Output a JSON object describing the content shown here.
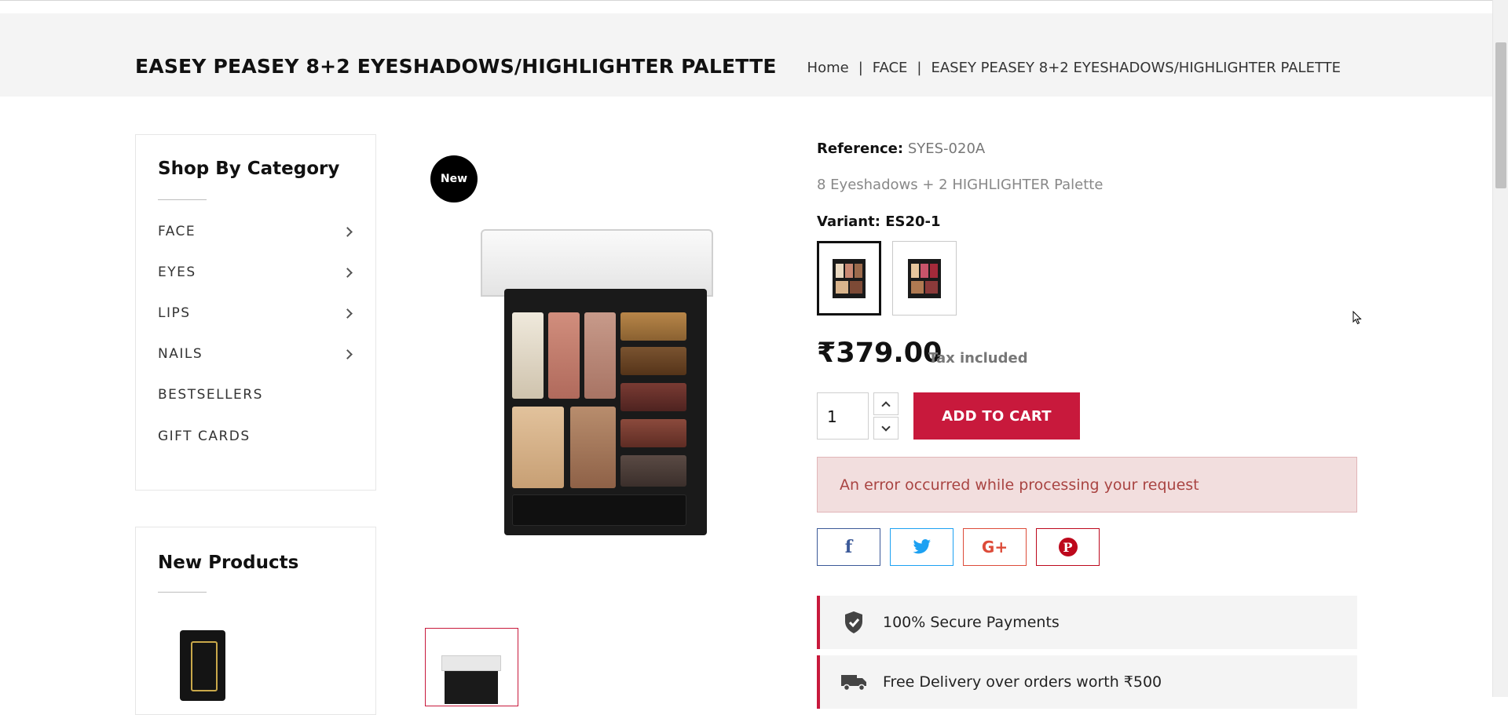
{
  "header": {
    "title": "EASEY PEASEY 8+2 EYESHADOWS/HIGHLIGHTER PALETTE",
    "breadcrumb": [
      "Home",
      "FACE",
      "EASEY PEASEY 8+2 EYESHADOWS/HIGHLIGHTER PALETTE"
    ],
    "breadcrumb_sep": "|"
  },
  "sidebar": {
    "category_title": "Shop By Category",
    "categories": [
      {
        "label": "FACE",
        "has_children": true
      },
      {
        "label": "EYES",
        "has_children": true
      },
      {
        "label": "LIPS",
        "has_children": true
      },
      {
        "label": "NAILS",
        "has_children": true
      },
      {
        "label": "BESTSELLERS",
        "has_children": false
      },
      {
        "label": "GIFT CARDS",
        "has_children": false
      }
    ],
    "new_products_title": "New Products"
  },
  "product": {
    "badge": "New",
    "reference_label": "Reference:",
    "reference_value": "SYES-020A",
    "description": "8 Eyeshadows + 2 HIGHLIGHTER Palette",
    "variant_label": "Variant:",
    "variant_value": "ES20-1",
    "price": "₹379.00",
    "tax_note": "Tax included",
    "quantity": "1",
    "add_to_cart": "ADD TO CART",
    "error": "An error occurred while processing your request"
  },
  "share": {
    "facebook": "f",
    "google_plus": "G+",
    "pinterest": "P"
  },
  "features": [
    {
      "icon": "shield-check-icon",
      "text": "100% Secure Payments"
    },
    {
      "icon": "truck-icon",
      "text": "Free Delivery over orders worth ₹500"
    }
  ],
  "colors": {
    "accent": "#c8193c",
    "alert_bg": "#f2dede",
    "alert_text": "#a94442",
    "facebook": "#3b5998",
    "twitter": "#1da1f2",
    "google_plus": "#dd4b39",
    "pinterest": "#bd081c"
  }
}
